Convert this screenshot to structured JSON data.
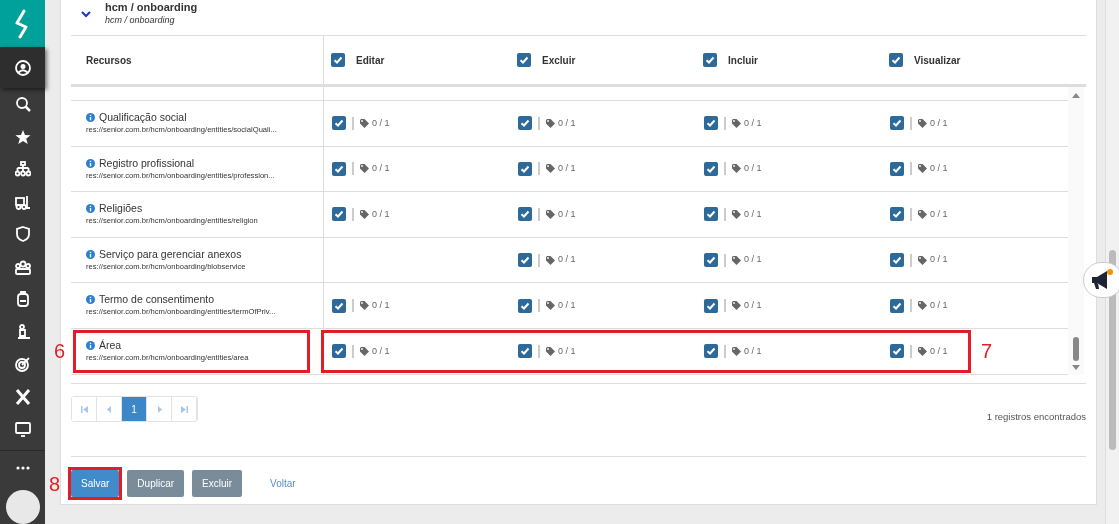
{
  "sidebar": {
    "items": [
      {
        "selected": true
      },
      {
        "selected": false
      },
      {
        "selected": false
      },
      {
        "selected": false
      },
      {
        "selected": false
      },
      {
        "selected": false
      },
      {
        "selected": false
      },
      {
        "selected": false
      },
      {
        "selected": false
      },
      {
        "selected": false
      },
      {
        "selected": false
      },
      {
        "selected": false
      }
    ]
  },
  "section": {
    "title": "hcm / onboarding",
    "subtitle": "hcm / onboarding",
    "expanded": true
  },
  "table": {
    "columns": [
      {
        "label": "Recursos",
        "kind": "text"
      },
      {
        "label": "Editar",
        "kind": "checkbox",
        "checked": true
      },
      {
        "label": "Excluir",
        "kind": "checkbox",
        "checked": true
      },
      {
        "label": "Incluir",
        "kind": "checkbox",
        "checked": true
      },
      {
        "label": "Visualizar",
        "kind": "checkbox",
        "checked": true
      }
    ],
    "rows": [
      {
        "cells": [
          {
            "kind": "resource",
            "name": "Qualificação social",
            "path": "res://senior.com.br/hcm/onboarding/entities/socialQuali..."
          },
          {
            "kind": "checkbox",
            "checked": true,
            "count": "0 / 1"
          },
          {
            "kind": "checkbox",
            "checked": true,
            "count": "0 / 1"
          },
          {
            "kind": "checkbox",
            "checked": true,
            "count": "0 / 1"
          },
          {
            "kind": "checkbox",
            "checked": true,
            "count": "0 / 1"
          }
        ]
      },
      {
        "cells": [
          {
            "kind": "resource",
            "name": "Registro profissional",
            "path": "res://senior.com.br/hcm/onboarding/entities/profession..."
          },
          {
            "kind": "checkbox",
            "checked": true,
            "count": "0 / 1"
          },
          {
            "kind": "checkbox",
            "checked": true,
            "count": "0 / 1"
          },
          {
            "kind": "checkbox",
            "checked": true,
            "count": "0 / 1"
          },
          {
            "kind": "checkbox",
            "checked": true,
            "count": "0 / 1"
          }
        ]
      },
      {
        "cells": [
          {
            "kind": "resource",
            "name": "Religiões",
            "path": "res://senior.com.br/hcm/onboarding/entities/religion"
          },
          {
            "kind": "checkbox",
            "checked": true,
            "count": "0 / 1"
          },
          {
            "kind": "checkbox",
            "checked": true,
            "count": "0 / 1"
          },
          {
            "kind": "checkbox",
            "checked": true,
            "count": "0 / 1"
          },
          {
            "kind": "checkbox",
            "checked": true,
            "count": "0 / 1"
          }
        ]
      },
      {
        "cells": [
          {
            "kind": "resource",
            "name": "Serviço para gerenciar anexos",
            "path": "res://senior.com.br/hcm/onboarding/blobservice"
          },
          {
            "kind": "empty"
          },
          {
            "kind": "checkbox",
            "checked": true,
            "count": "0 / 1"
          },
          {
            "kind": "checkbox",
            "checked": true,
            "count": "0 / 1"
          },
          {
            "kind": "checkbox",
            "checked": true,
            "count": "0 / 1"
          }
        ]
      },
      {
        "cells": [
          {
            "kind": "resource",
            "name": "Termo de consentimento",
            "path": "res://senior.com.br/hcm/onboarding/entities/termOfPriv..."
          },
          {
            "kind": "checkbox",
            "checked": true,
            "count": "0 / 1"
          },
          {
            "kind": "checkbox",
            "checked": true,
            "count": "0 / 1"
          },
          {
            "kind": "checkbox",
            "checked": true,
            "count": "0 / 1"
          },
          {
            "kind": "checkbox",
            "checked": true,
            "count": "0 / 1"
          }
        ]
      },
      {
        "resource_callout": "6",
        "permissions_callout": "7",
        "cells": [
          {
            "kind": "resource",
            "name": "Área",
            "path": "res://senior.com.br/hcm/onboarding/entities/area"
          },
          {
            "kind": "checkbox",
            "checked": true,
            "count": "0 / 1"
          },
          {
            "kind": "checkbox",
            "checked": true,
            "count": "0 / 1"
          },
          {
            "kind": "checkbox",
            "checked": true,
            "count": "0 / 1"
          },
          {
            "kind": "checkbox",
            "checked": true,
            "count": "0 / 1"
          }
        ]
      }
    ]
  },
  "pagination": {
    "pages": [
      {
        "label": "1",
        "selected": true
      }
    ]
  },
  "record_count": "1 registros encontrados",
  "buttons": [
    {
      "label": "Salvar",
      "kind": "primary",
      "callout": "8"
    },
    {
      "label": "Duplicar",
      "kind": "secondary"
    },
    {
      "label": "Excluir",
      "kind": "secondary"
    },
    {
      "label": "Voltar",
      "kind": "link"
    }
  ]
}
